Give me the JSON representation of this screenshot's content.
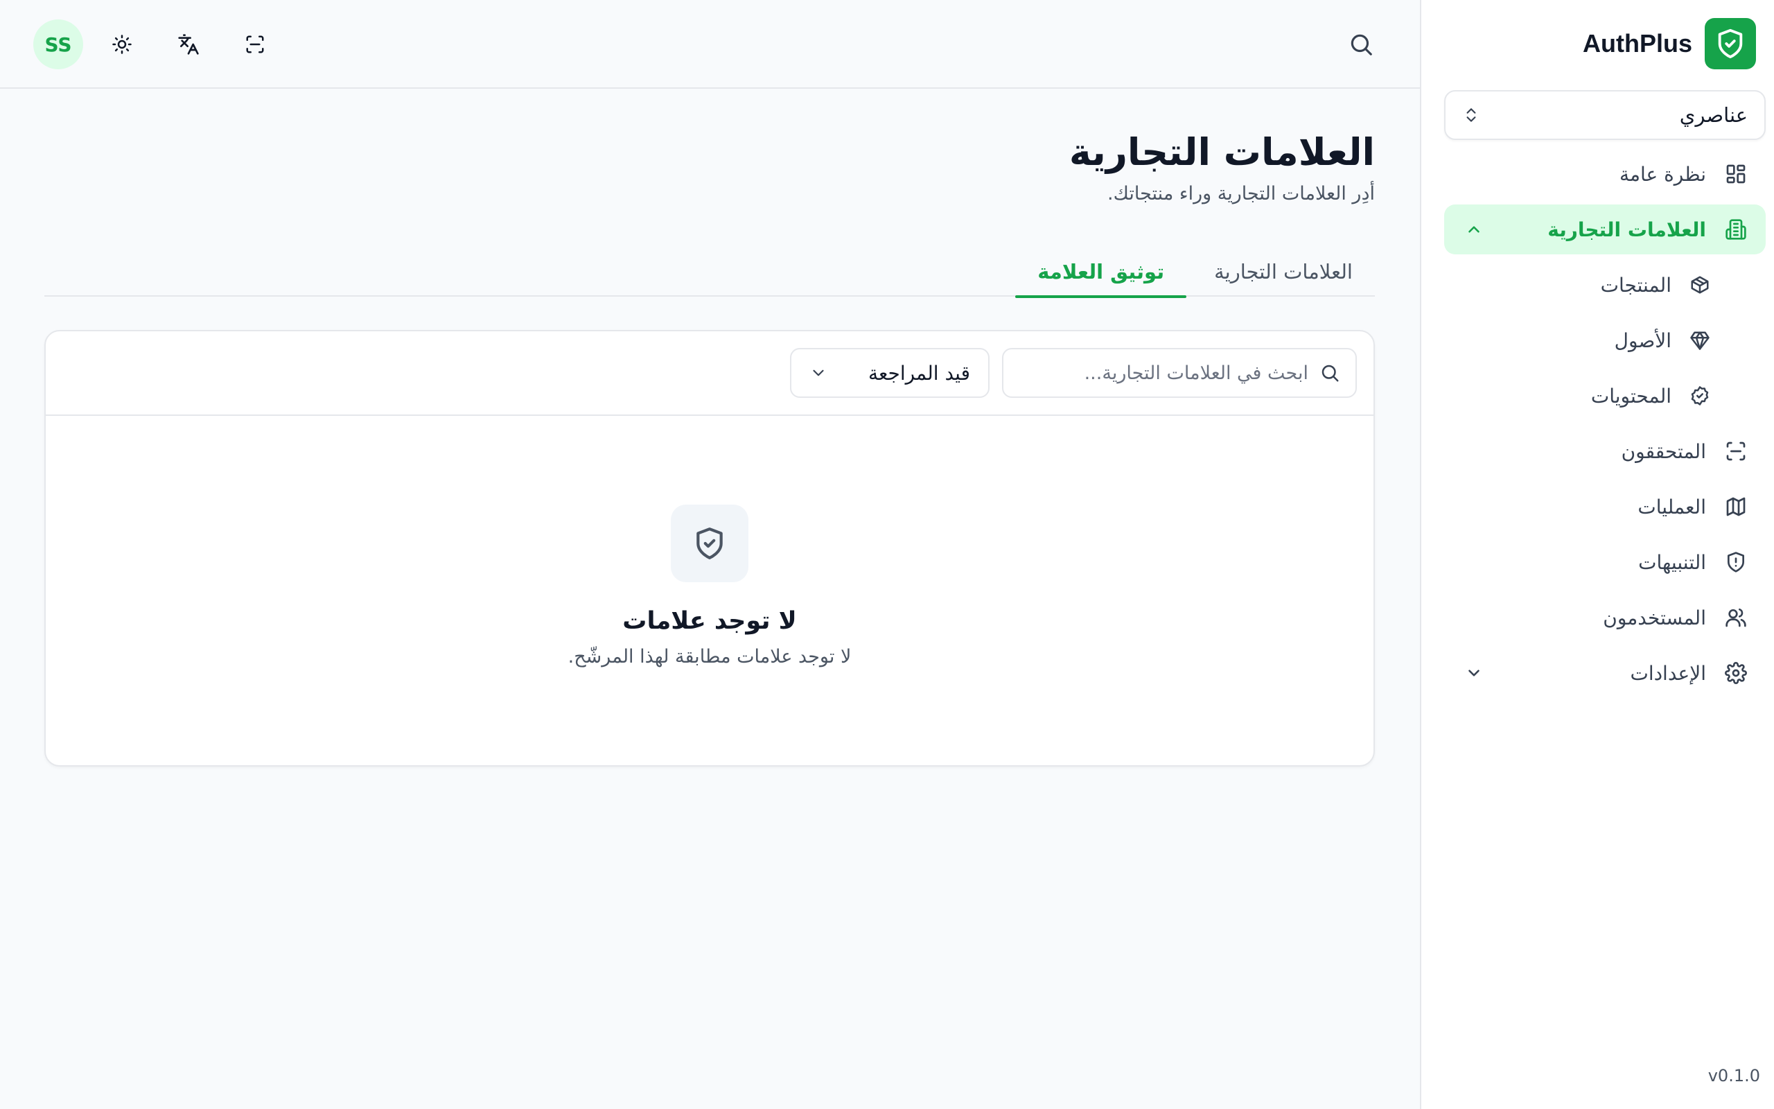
{
  "app": {
    "name": "AuthPlus",
    "version": "v0.1.0"
  },
  "colors": {
    "accent": "#16a34a",
    "accent_soft": "#dcfce7"
  },
  "topbar": {
    "avatar_initials": "SS",
    "icons": [
      "sun-icon",
      "translate-icon",
      "scan-icon",
      "search-icon"
    ]
  },
  "sidebar": {
    "org_select": {
      "value": "عناصري"
    },
    "items": [
      {
        "label": "نظرة عامة",
        "icon": "dashboard-icon"
      },
      {
        "label": "العلامات التجارية",
        "icon": "building-icon",
        "active": true,
        "expanded": true,
        "children": [
          {
            "label": "المنتجات",
            "icon": "package-icon"
          },
          {
            "label": "الأصول",
            "icon": "gem-icon"
          },
          {
            "label": "المحتويات",
            "icon": "badge-check-icon"
          }
        ]
      },
      {
        "label": "المتحققون",
        "icon": "scan-icon"
      },
      {
        "label": "العمليات",
        "icon": "map-icon"
      },
      {
        "label": "التنبيهات",
        "icon": "shield-alert-icon"
      },
      {
        "label": "المستخدمون",
        "icon": "users-icon"
      },
      {
        "label": "الإعدادات",
        "icon": "settings-icon",
        "expanded": false
      }
    ]
  },
  "main": {
    "title": "العلامات التجارية",
    "subtitle": "أدِر العلامات التجارية وراء منتجاتك.",
    "tabs": [
      {
        "label": "العلامات التجارية",
        "active": false
      },
      {
        "label": "توثيق العلامة",
        "active": true
      }
    ],
    "search": {
      "placeholder": "ابحث في العلامات التجارية...",
      "value": ""
    },
    "status_filter": {
      "value": "قيد المراجعة"
    },
    "empty_state": {
      "icon": "shield-check-icon",
      "title": "لا توجد علامات",
      "description": "لا توجد علامات مطابقة لهذا المرشّح."
    }
  }
}
